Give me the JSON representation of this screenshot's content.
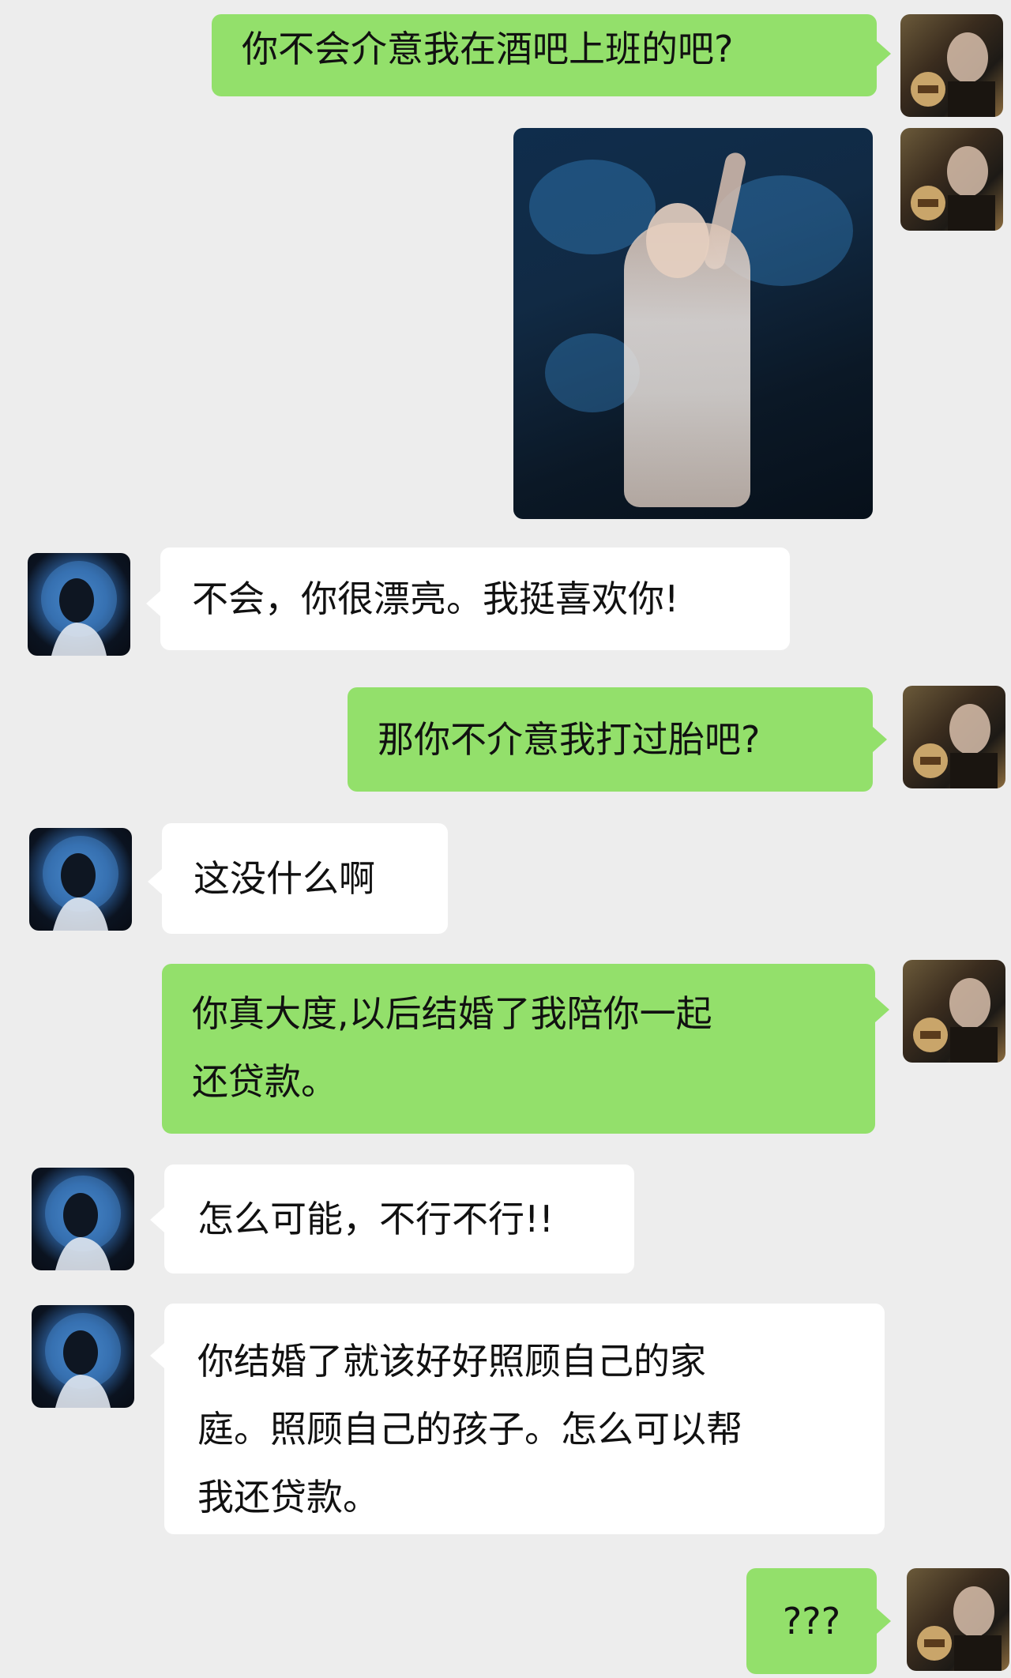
{
  "messages": [
    {
      "side": "right",
      "text": "你不会介意我在酒吧上班的吧?"
    },
    {
      "side": "right",
      "type": "image"
    },
    {
      "side": "left",
      "text": "不会，你很漂亮。我挺喜欢你!"
    },
    {
      "side": "right",
      "text": "那你不介意我打过胎吧?"
    },
    {
      "side": "left",
      "text": "这没什么啊"
    },
    {
      "side": "right",
      "lines": [
        "你真大度,以后结婚了我陪你一起",
        "还贷款。"
      ]
    },
    {
      "side": "left",
      "text": "怎么可能，不行不行!!"
    },
    {
      "side": "left",
      "lines": [
        "你结婚了就该好好照顾自己的家",
        "庭。照顾自己的孩子。怎么可以帮",
        "我还贷款。"
      ]
    },
    {
      "side": "right",
      "text": "???"
    }
  ],
  "colors": {
    "background": "#ededed",
    "sent_bubble": "#93e06b",
    "received_bubble": "#ffffff"
  },
  "avatars": {
    "sender": "girl-avatar",
    "receiver": "boy-avatar"
  }
}
